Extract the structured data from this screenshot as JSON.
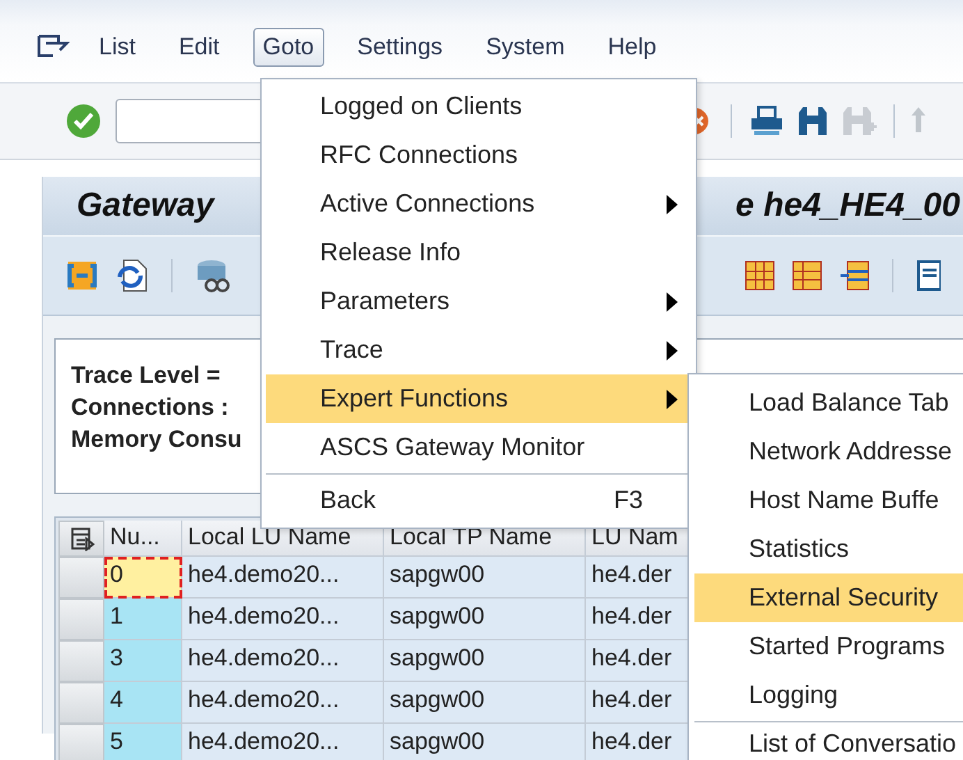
{
  "menubar": [
    {
      "label": "List",
      "selected": false
    },
    {
      "label": "Edit",
      "selected": false
    },
    {
      "label": "Goto",
      "selected": true
    },
    {
      "label": "Settings",
      "selected": false
    },
    {
      "label": "System",
      "selected": false
    },
    {
      "label": "Help",
      "selected": false
    }
  ],
  "title": {
    "left": "Gateway",
    "right": "e he4_HE4_00"
  },
  "info": [
    "Trace Level =",
    "Connections :",
    "Memory Consu"
  ],
  "table": {
    "columns": [
      "Nu...",
      "Local LU Name",
      "Local TP Name",
      "LU Nam"
    ],
    "rows": [
      {
        "cells": [
          "0",
          "he4.demo20...",
          "sapgw00",
          "he4.der"
        ],
        "focused": true
      },
      {
        "cells": [
          "1",
          "he4.demo20...",
          "sapgw00",
          "he4.der"
        ],
        "focused": false
      },
      {
        "cells": [
          "3",
          "he4.demo20...",
          "sapgw00",
          "he4.der"
        ],
        "focused": false
      },
      {
        "cells": [
          "4",
          "he4.demo20...",
          "sapgw00",
          "he4.der"
        ],
        "focused": false
      },
      {
        "cells": [
          "5",
          "he4.demo20...",
          "sapgw00",
          "he4.der"
        ],
        "focused": false
      }
    ]
  },
  "goto_menu": [
    {
      "kind": "item",
      "label": "Logged on Clients",
      "submenu": false,
      "selected": false
    },
    {
      "kind": "item",
      "label": "RFC Connections",
      "submenu": false,
      "selected": false
    },
    {
      "kind": "item",
      "label": "Active Connections",
      "submenu": true,
      "selected": false
    },
    {
      "kind": "item",
      "label": "Release Info",
      "submenu": false,
      "selected": false
    },
    {
      "kind": "item",
      "label": "Parameters",
      "submenu": true,
      "selected": false
    },
    {
      "kind": "item",
      "label": "Trace",
      "submenu": true,
      "selected": false
    },
    {
      "kind": "item",
      "label": "Expert Functions",
      "submenu": true,
      "selected": true
    },
    {
      "kind": "item",
      "label": "ASCS Gateway Monitor",
      "submenu": false,
      "selected": false
    },
    {
      "kind": "separator"
    },
    {
      "kind": "item",
      "label": "Back",
      "shortcut": "F3",
      "submenu": false,
      "selected": false
    }
  ],
  "expert_submenu": [
    {
      "kind": "item",
      "label": "Load Balance Tab",
      "selected": false
    },
    {
      "kind": "item",
      "label": "Network Addresse",
      "selected": false
    },
    {
      "kind": "item",
      "label": "Host Name Buffe",
      "selected": false
    },
    {
      "kind": "item",
      "label": "Statistics",
      "selected": false
    },
    {
      "kind": "item",
      "label": "External Security",
      "selected": true
    },
    {
      "kind": "item",
      "label": "Started Programs",
      "selected": false
    },
    {
      "kind": "item",
      "label": "Logging",
      "selected": false
    },
    {
      "kind": "separator"
    },
    {
      "kind": "item",
      "label": "List of Conversatio",
      "selected": false
    }
  ]
}
